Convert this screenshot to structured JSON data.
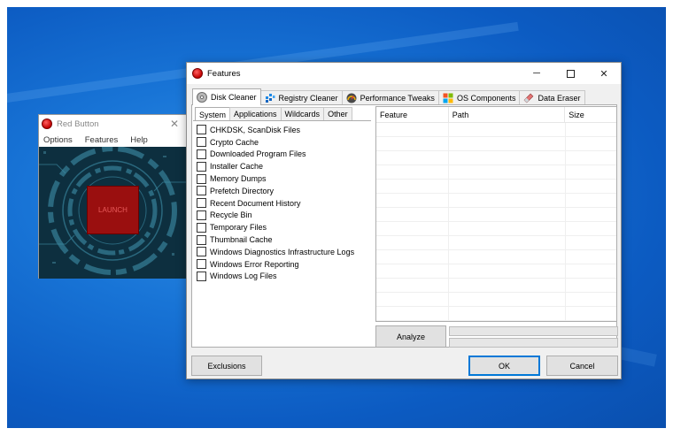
{
  "red_button_window": {
    "title": "Red Button",
    "close_glyph": "✕",
    "menu": [
      "Options",
      "Features",
      "Help"
    ],
    "launch_label": "LAUNCH"
  },
  "features_window": {
    "title": "Features",
    "controls": {
      "minimize": "─",
      "close": "✕"
    },
    "tabs": [
      {
        "label": "Disk Cleaner",
        "icon": "disk-icon"
      },
      {
        "label": "Registry Cleaner",
        "icon": "registry-icon"
      },
      {
        "label": "Performance Tweaks",
        "icon": "speedometer-icon"
      },
      {
        "label": "OS Components",
        "icon": "windows-logo-icon"
      },
      {
        "label": "Data Eraser",
        "icon": "eraser-icon"
      }
    ],
    "subtabs": [
      "System",
      "Applications",
      "Wildcards",
      "Other"
    ],
    "system_items": [
      "CHKDSK, ScanDisk Files",
      "Crypto Cache",
      "Downloaded Program Files",
      "Installer Cache",
      "Memory Dumps",
      "Prefetch Directory",
      "Recent Document History",
      "Recycle Bin",
      "Temporary Files",
      "Thumbnail Cache",
      "Windows Diagnostics Infrastructure Logs",
      "Windows Error Reporting",
      "Windows Log Files"
    ],
    "results_columns": [
      "Feature",
      "Path",
      "Size"
    ],
    "analyze_label": "Analyze",
    "buttons": {
      "exclusions": "Exclusions",
      "ok": "OK",
      "cancel": "Cancel"
    }
  },
  "colors": {
    "desktop": "#1874d6",
    "launch_button": "#9a0f0f",
    "default_button_border": "#0078d7"
  }
}
